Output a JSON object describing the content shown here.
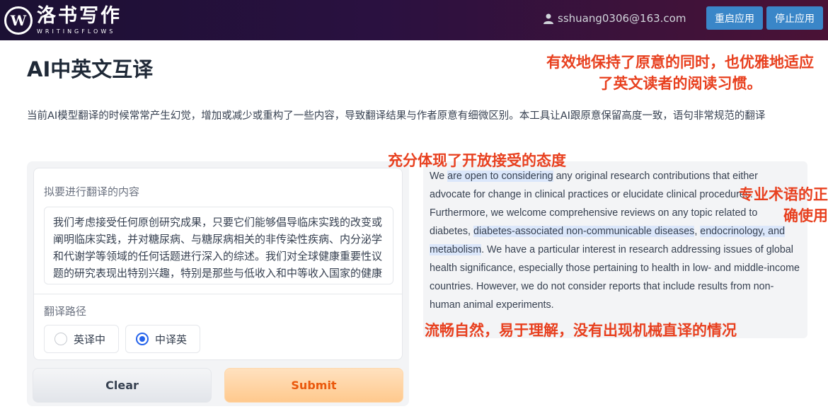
{
  "header": {
    "logo_mark": "W",
    "logo_cn": "洛书写作",
    "logo_en": "WRITINGFLOWS",
    "user_email": "sshuang0306@163.com",
    "restart_label": "重启应用",
    "stop_label": "停止应用"
  },
  "page": {
    "title": "AI中英文互译",
    "description": "当前AI模型翻译的时候常常产生幻觉，增加或减少或重构了一些内容，导致翻译结果与作者原意有细微区别。本工具让AI跟原意保留高度一致，语句非常规范的翻译"
  },
  "input": {
    "label": "拟要进行翻译的内容",
    "text": "我们考虑接受任何原创研究成果，只要它们能够倡导临床实践的改变或阐明临床实践，并对糖尿病、与糖尿病相关的非传染性疾病、内分泌学和代谢学等领域的任何话题进行深入的综述。我们对全球健康重要性议题的研究表现出特别兴趣，特别是那些与低收入和中等收入国家的健康相关的研究。我们不考虑包括非人类动物实验结果的报告。"
  },
  "route": {
    "label": "翻译路径",
    "options": [
      "英译中",
      "中译英"
    ],
    "selected": "中译英"
  },
  "actions": {
    "clear_label": "Clear",
    "submit_label": "Submit"
  },
  "output": {
    "s1": "We ",
    "h1": "are open to considering",
    "s2": " any original research contributions that either advocate for change in clinical practices or elucidate clinical procedures. Furthermore, we welcome comprehensive reviews on any topic related to diabetes, ",
    "h2": "diabetes-associated non-communicable diseases",
    "s3": ", ",
    "h3": "endocrinology, and metabolism",
    "s4": ". We have a particular interest in research addressing issues of global health significance, especially those pertaining to health in low- and middle-income countries. However, we do not consider reports that include results from non-human animal experiments."
  },
  "annotations": {
    "a1": "有效地保持了原意的同时，也优雅地适应了英文读者的阅读习惯。",
    "a2": "充分体现了开放接受的态度",
    "a3": "专业术语的正确使用",
    "a4": "流畅自然，易于理解，没有出现机械直译的情况"
  },
  "colors": {
    "annotation": "#e8401f",
    "highlight": "#dbe7fb",
    "accent": "#2563eb",
    "top_button": "#3a86c8"
  }
}
